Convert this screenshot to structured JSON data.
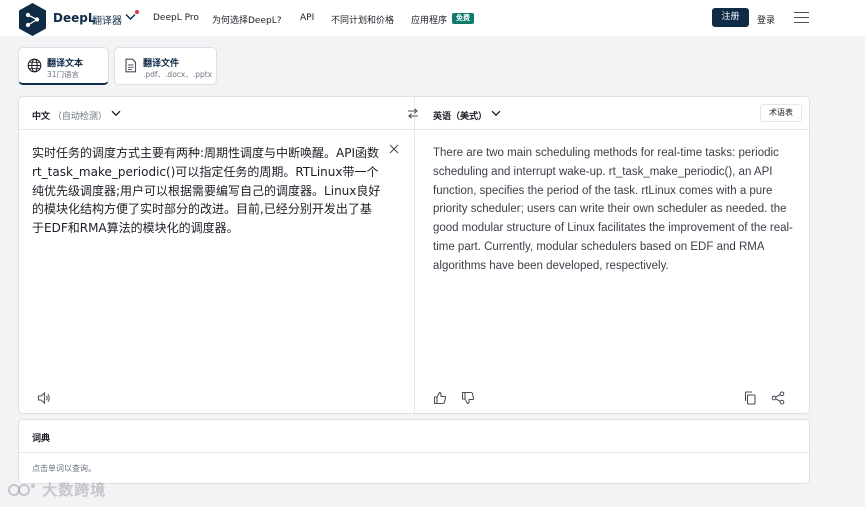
{
  "header": {
    "brand": "DeepL",
    "brand_sub": "翻译器",
    "nav": [
      "DeepL Pro",
      "为何选择DeepL?",
      "API",
      "不同计划和价格",
      "应用程序"
    ],
    "free_badge": "免费",
    "register": "注册",
    "login": "登录"
  },
  "modes": [
    {
      "title": "翻译文本",
      "subtitle": "31门语言",
      "icon": "globe-icon"
    },
    {
      "title": "翻译文件",
      "subtitle": ".pdf、.docx、.pptx",
      "icon": "document-icon"
    }
  ],
  "source": {
    "language": "中文",
    "detect": "（自动检测）",
    "text": "实时任务的调度方式主要有两种:周期性调度与中断唤醒。API函数rt_task_make_periodic()可以指定任务的周期。RTLinux带一个纯优先级调度器;用户可以根据需要编写自己的调度器。Linux良好的模块化结构方便了实时部分的改进。目前,已经分别开发出了基于EDF和RMA算法的模块化的调度器。"
  },
  "target": {
    "language": "英语（美式）",
    "glossary": "术语表",
    "text": "There are two main scheduling methods for real-time tasks: periodic scheduling and interrupt wake-up. rt_task_make_periodic(), an API function, specifies the period of the task. rtLinux comes with a pure priority scheduler; users can write their own scheduler as needed. the good modular structure of Linux facilitates the improvement of the real-time part. Currently, modular schedulers based on EDF and RMA algorithms have been developed, respectively."
  },
  "dictionary": {
    "title": "词典",
    "hint": "点击单词以查询。"
  },
  "watermark": "大数跨境",
  "colors": {
    "brand": "#0f2b46",
    "free_badge": "#0f7b6c",
    "notification_dot": "#e0344c"
  }
}
